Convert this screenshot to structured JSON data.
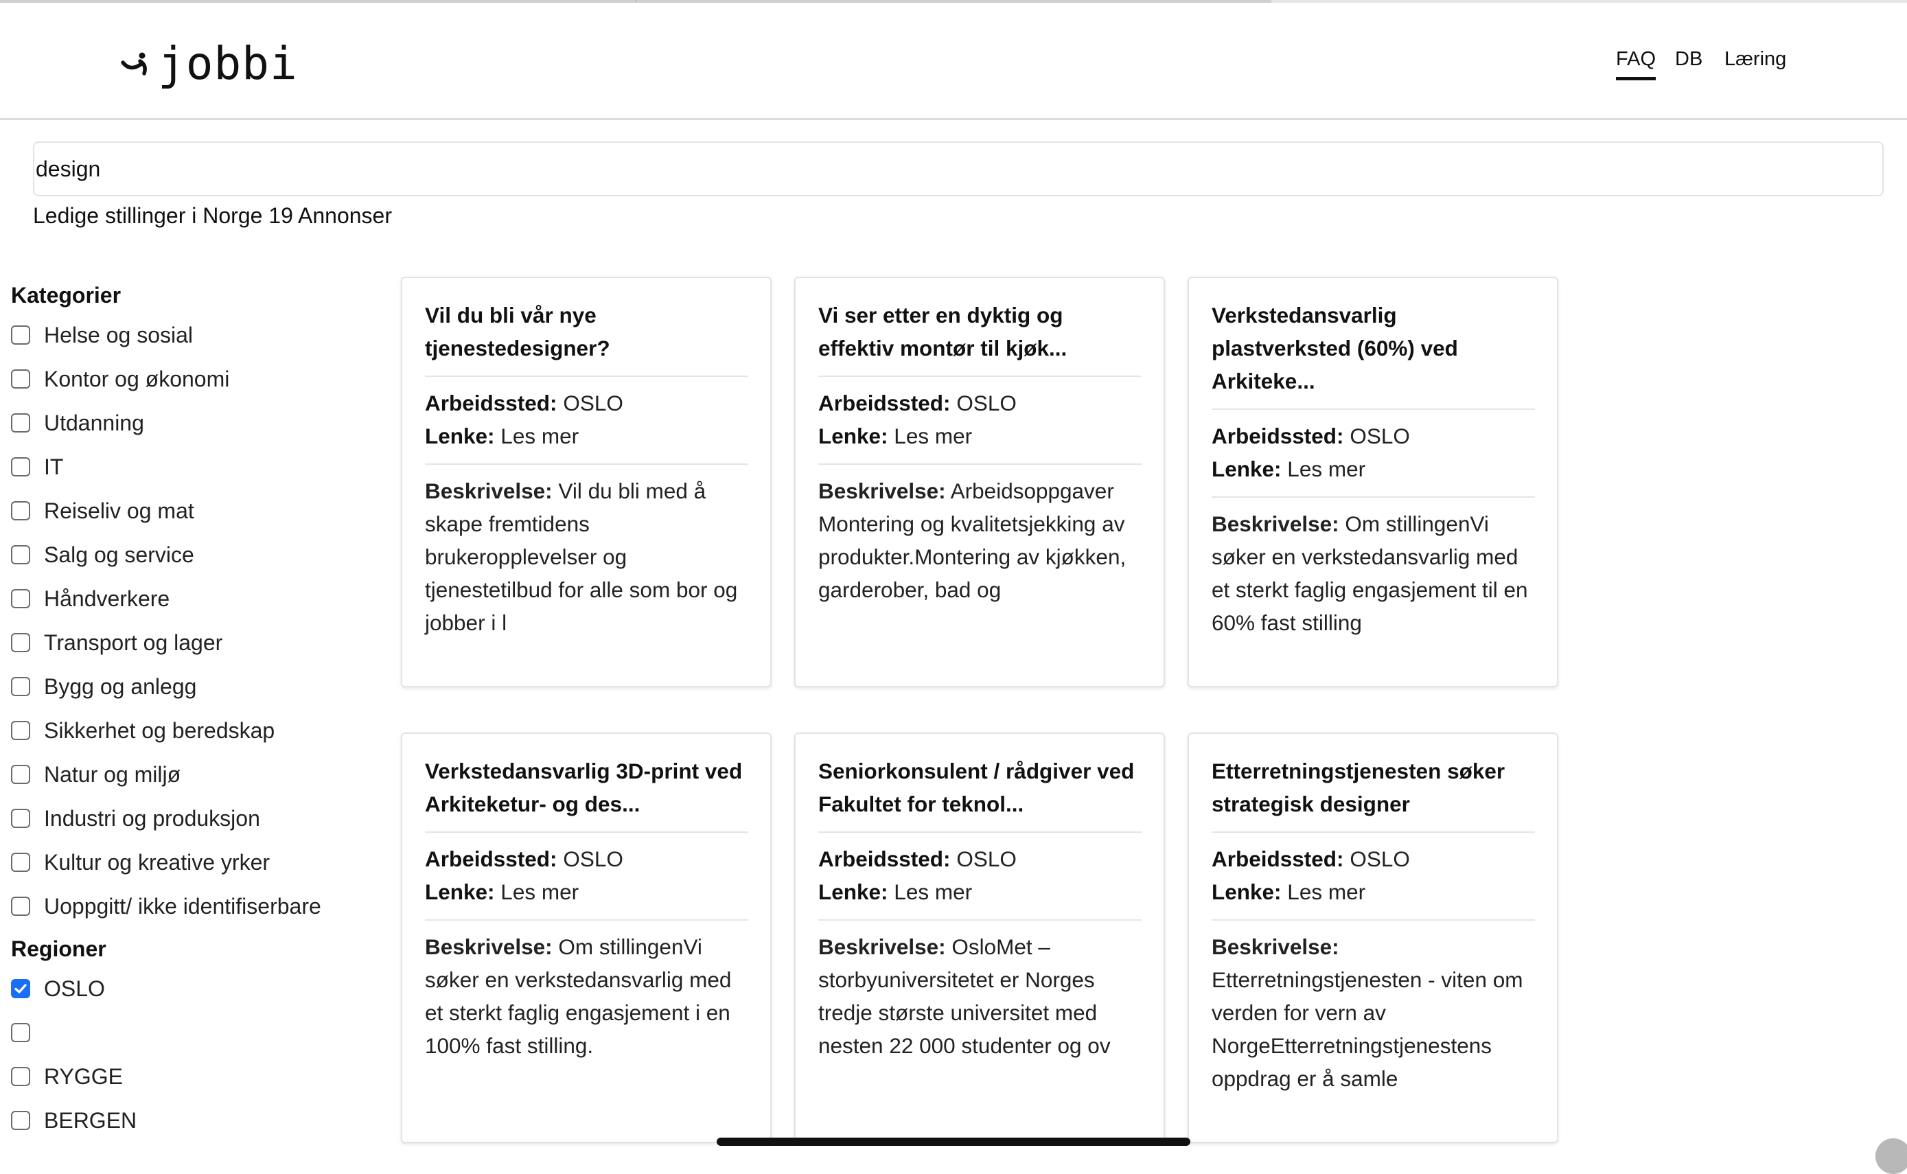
{
  "app": {
    "logo_text": "jobbi"
  },
  "nav": {
    "items": [
      {
        "label": "FAQ",
        "active": true
      },
      {
        "label": "DB",
        "active": false
      },
      {
        "label": "Læring",
        "active": false
      }
    ]
  },
  "search": {
    "value": "design"
  },
  "results": {
    "summary": "Ledige stillinger i Norge 19 Annonser"
  },
  "sidebar": {
    "categories_heading": "Kategorier",
    "categories": [
      {
        "label": "Helse og sosial",
        "checked": false
      },
      {
        "label": "Kontor og økonomi",
        "checked": false
      },
      {
        "label": "Utdanning",
        "checked": false
      },
      {
        "label": "IT",
        "checked": false
      },
      {
        "label": "Reiseliv og mat",
        "checked": false
      },
      {
        "label": "Salg og service",
        "checked": false
      },
      {
        "label": "Håndverkere",
        "checked": false
      },
      {
        "label": "Transport og lager",
        "checked": false
      },
      {
        "label": "Bygg og anlegg",
        "checked": false
      },
      {
        "label": "Sikkerhet og beredskap",
        "checked": false
      },
      {
        "label": "Natur og miljø",
        "checked": false
      },
      {
        "label": "Industri og produksjon",
        "checked": false
      },
      {
        "label": "Kultur og kreative yrker",
        "checked": false
      },
      {
        "label": "Uoppgitt/ ikke identifiserbare",
        "checked": false
      }
    ],
    "regions_heading": "Regioner",
    "regions": [
      {
        "label": "OSLO",
        "checked": true
      },
      {
        "label": "",
        "checked": false
      },
      {
        "label": "RYGGE",
        "checked": false
      },
      {
        "label": "BERGEN",
        "checked": false
      }
    ]
  },
  "field_labels": {
    "workplace": "Arbeidssted:",
    "link": "Lenke:",
    "description": "Beskrivelse:"
  },
  "jobs": [
    {
      "title": "Vil du bli vår nye tjenestedesigner?",
      "workplace": "OSLO",
      "link_text": "Les mer",
      "description": "Vil du bli med å skape fremtidens brukeropplevelser og tjenestetilbud for alle som bor og jobber i l"
    },
    {
      "title": "Vi ser etter en dyktig og effektiv montør til kjøk...",
      "workplace": "OSLO",
      "link_text": "Les mer",
      "description": "Arbeidsoppgaver Montering og kvalitetsjekking av produkter.Montering av kjøkken, garderober, bad og"
    },
    {
      "title": "Verkstedansvarlig plastverksted (60%) ved Arkiteke...",
      "workplace": "OSLO",
      "link_text": "Les mer",
      "description": "Om stillingenVi søker en verkstedansvarlig med et sterkt faglig engasjement til en 60% fast stilling"
    },
    {
      "title": "Verkstedansvarlig 3D-print ved Arkiteketur- og des...",
      "workplace": "OSLO",
      "link_text": "Les mer",
      "description": "Om stillingenVi søker en verkstedansvarlig med et sterkt faglig engasjement i en 100% fast stilling."
    },
    {
      "title": "Seniorkonsulent / rådgiver ved Fakultet for teknol...",
      "workplace": "OSLO",
      "link_text": "Les mer",
      "description": "OsloMet – storbyuniversitetet er Norges tredje største universitet med nesten 22 000 studenter og ov"
    },
    {
      "title": "Etterretningstjenesten søker strategisk designer",
      "workplace": "OSLO",
      "link_text": "Les mer",
      "description": "Etterretningstjenesten - viten om verden for vern av NorgeEtterretningstjenestens oppdrag er å samle"
    }
  ],
  "colors": {
    "checkbox_accent": "#1a6ef5",
    "text": "#111111",
    "border": "#e3e3e3"
  },
  "icons": {
    "logo": "smile-logo-icon",
    "checkmark": "checkmark-icon"
  }
}
